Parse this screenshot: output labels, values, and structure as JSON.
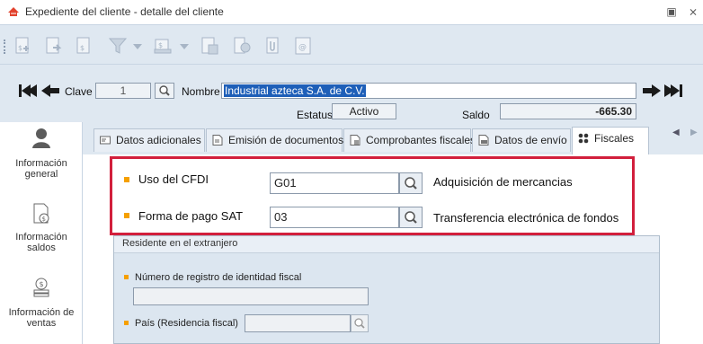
{
  "window": {
    "title": "Expediente del cliente - detalle del cliente",
    "minimize_glyph": "▣",
    "close_glyph": "⨯"
  },
  "toolbar": {
    "icons": [
      "add-record-icon",
      "add-record-arrow-icon",
      "record-detail-icon",
      "filter-icon",
      "filter-dropdown-icon",
      "register-icon",
      "register-dropdown-icon",
      "calculator-icon",
      "coins-icon",
      "attach-icon",
      "id-card-icon"
    ]
  },
  "client": {
    "clave_label": "Clave",
    "clave_value": "1",
    "nombre_label": "Nombre",
    "nombre_value": "Industrial azteca S.A. de C.V.",
    "estatus_label": "Estatus",
    "estatus_value": "Activo",
    "saldo_label": "Saldo",
    "saldo_value": "-665.30"
  },
  "sidebar": {
    "items": [
      {
        "label_line1": "Información",
        "label_line2": "general",
        "icon": "person-icon"
      },
      {
        "label_line1": "Información",
        "label_line2": "saldos",
        "icon": "document-money-icon"
      },
      {
        "label_line1": "Información de",
        "label_line2": "ventas",
        "icon": "coins-stack-icon"
      }
    ]
  },
  "tabs": [
    {
      "label": "Datos adicionales",
      "icon": "card-icon",
      "active": false
    },
    {
      "label": "Emisión de documentos",
      "icon": "document-icon",
      "active": false
    },
    {
      "label": "Comprobantes fiscales",
      "icon": "receipt-icon",
      "active": false
    },
    {
      "label": "Datos de envío",
      "icon": "truck-document-icon",
      "active": false
    },
    {
      "label": "Fiscales",
      "icon": "grid-icon",
      "active": true
    }
  ],
  "fiscales": {
    "uso_label": "Uso del CFDI",
    "uso_value": "G01",
    "uso_desc": "Adquisición de mercancias",
    "forma_label": "Forma de pago SAT",
    "forma_value": "03",
    "forma_desc": "Transferencia electrónica de fondos"
  },
  "residente": {
    "header": "Residente en el extranjero",
    "registro_label": "Número de registro de identidad fiscal",
    "registro_value": "",
    "pais_label": "País (Residencia fiscal)",
    "pais_value": ""
  },
  "colors": {
    "accent_bullet": "#f5a000",
    "highlight_border": "#d21f3c",
    "selection": "#1e5fb8"
  }
}
